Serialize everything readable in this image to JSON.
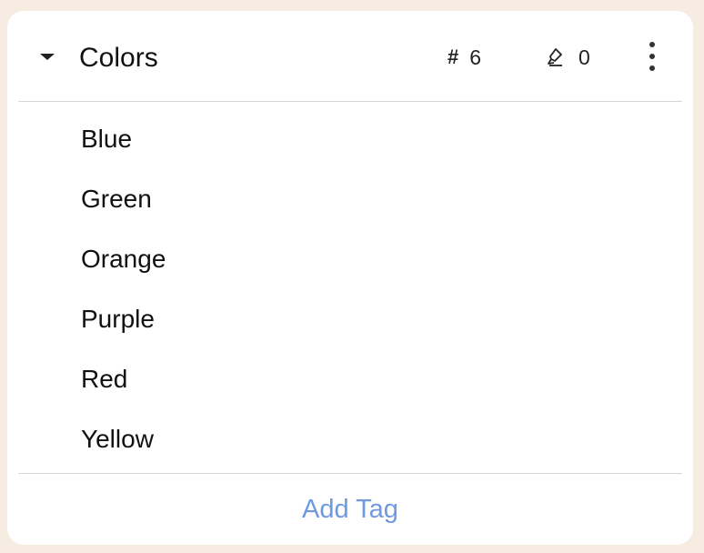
{
  "group": {
    "title": "Colors",
    "tag_count": "6",
    "highlight_count": "0",
    "tag_count_icon": "hash-icon",
    "highlight_count_icon": "highlighter-icon",
    "menu_icon": "more-vertical-icon",
    "collapse_icon": "caret-down-icon"
  },
  "tags": [
    {
      "label": "Blue"
    },
    {
      "label": "Green"
    },
    {
      "label": "Orange"
    },
    {
      "label": "Purple"
    },
    {
      "label": "Red"
    },
    {
      "label": "Yellow"
    }
  ],
  "footer": {
    "add_tag_label": "Add Tag"
  },
  "colors": {
    "background": "#f6ece2",
    "card": "#ffffff",
    "accent_link": "#6f9ae3",
    "divider": "#d6d6d6"
  }
}
